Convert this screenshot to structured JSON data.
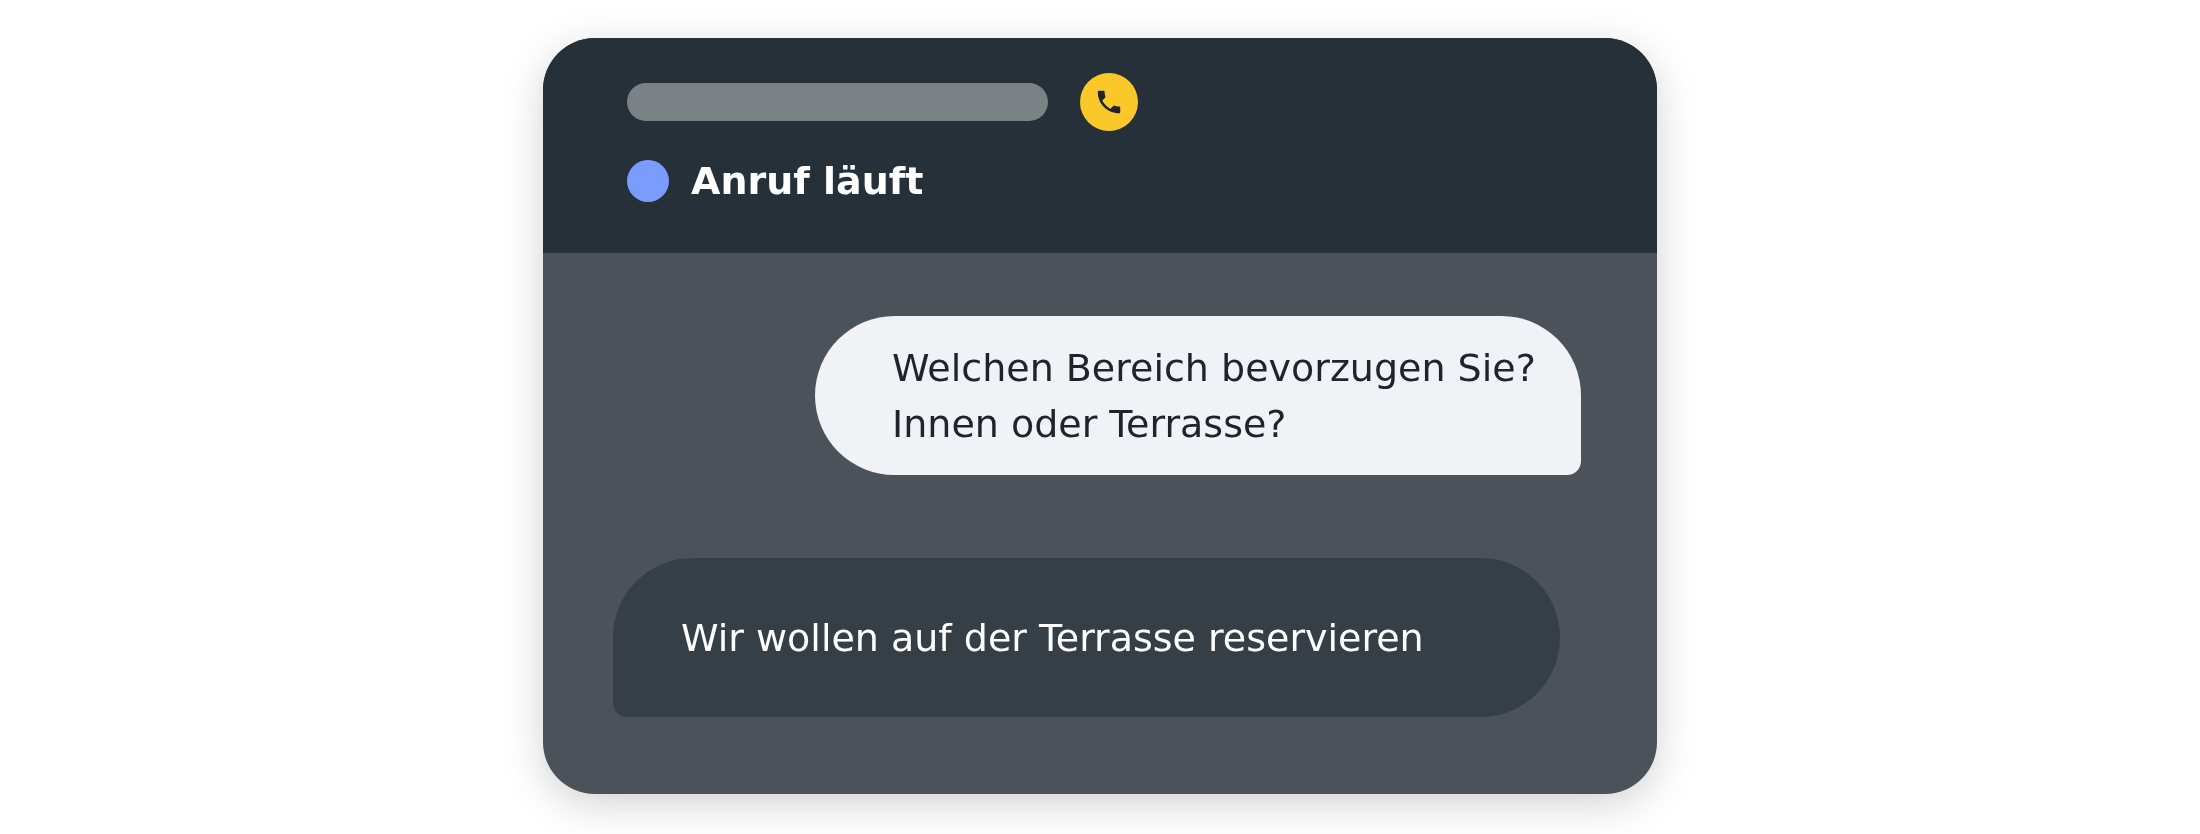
{
  "header": {
    "status": {
      "label": "Anruf läuft",
      "color": "#7b9cff"
    }
  },
  "messages": [
    {
      "kind": "agent",
      "text": "Welchen Bereich bevorzugen Sie? Innen oder Terrasse?"
    },
    {
      "kind": "user",
      "text": "Wir wollen auf der Terrasse reservieren"
    }
  ]
}
